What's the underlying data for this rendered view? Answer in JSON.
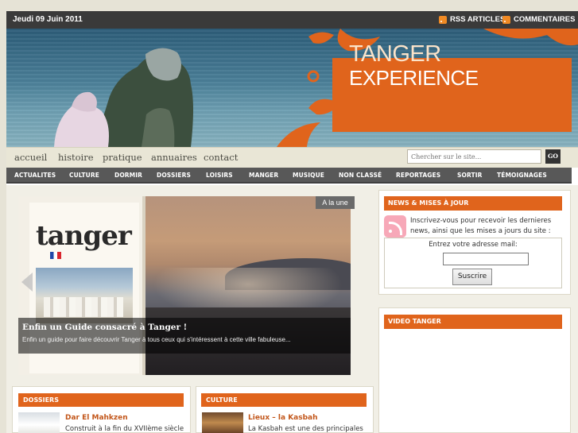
{
  "topbar": {
    "date": "Jeudi 09 Juin 2011",
    "rss_articles": "RSS ARTICLES",
    "rss_comments": "COMMENTAIRES"
  },
  "banner": {
    "logo_line1": "TANGER",
    "logo_line2": "EXPERIENCE"
  },
  "menu": {
    "items": [
      "accueil",
      "histoire",
      "pratique",
      "annuaires",
      "contact"
    ]
  },
  "search": {
    "placeholder": "Chercher sur le site...",
    "go_label": "GO"
  },
  "categories": [
    "ACTUALITES",
    "CULTURE",
    "DORMIR",
    "DOSSIERS",
    "LOISIRS",
    "MANGER",
    "MUSIQUE",
    "NON CLASSÉ",
    "REPORTAGES",
    "SORTIR",
    "TÉMOIGNAGES"
  ],
  "featured": {
    "badge": "A la une",
    "book_title": "tanger",
    "title": "Enfin un Guide consacré à Tanger !",
    "excerpt": "Enfin un guide pour faire découvrir Tanger à tous ceux qui s'intéressent à cette ville fabuleuse..."
  },
  "boxes": {
    "dossiers": {
      "heading": "DOSSIERS",
      "post_title": "Dar El Mahkzen",
      "post_excerpt": "Construit à la fin du XVIIème siècle"
    },
    "culture": {
      "heading": "CULTURE",
      "post_title": "Lieux – la Kasbah",
      "post_excerpt": "La Kasbah est une des principales"
    }
  },
  "sidebar": {
    "news_heading": "NEWS & MISES À JOUR",
    "news_text": "Inscrivez-vous pour recevoir les dernieres news, ainsi que les mises a jours du site :",
    "email_label": "Entrez votre adresse mail:",
    "subscribe_label": "Suscrire",
    "video_heading": "VIDEO TANGER"
  },
  "colors": {
    "accent": "#e0641c",
    "topbar": "#3a3a3a",
    "catnav": "#585858"
  }
}
